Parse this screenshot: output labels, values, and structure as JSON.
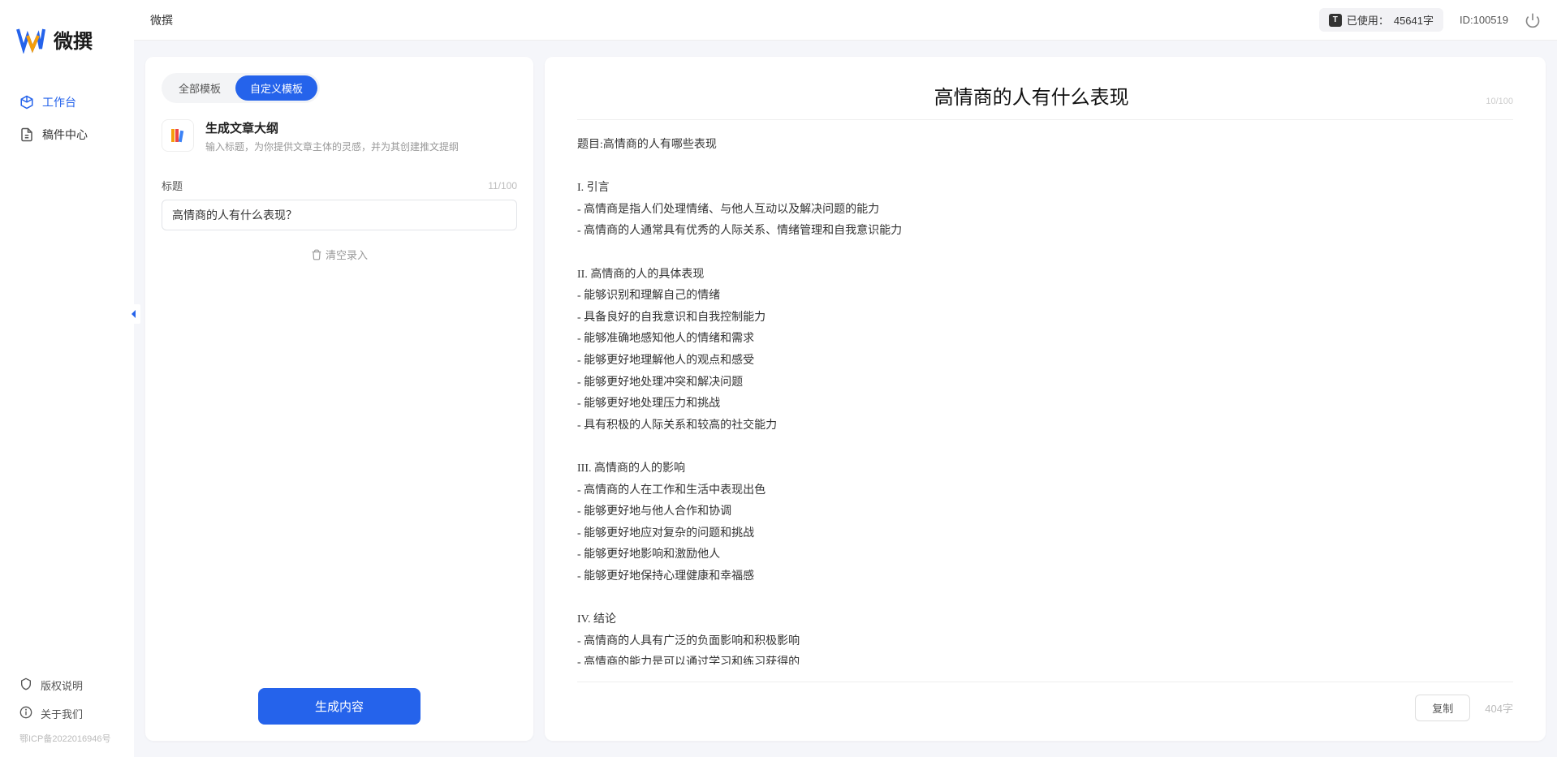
{
  "app": {
    "logo_text": "微撰"
  },
  "sidebar": {
    "nav_items": [
      {
        "label": "工作台",
        "active": true
      },
      {
        "label": "稿件中心",
        "active": false
      }
    ],
    "footer_items": [
      {
        "label": "版权说明"
      },
      {
        "label": "关于我们"
      }
    ],
    "icp": "鄂ICP备2022016946号"
  },
  "topbar": {
    "breadcrumb": "微撰",
    "usage_label": "已使用：",
    "usage_value": "45641字",
    "user_id_label": "ID:100519"
  },
  "form": {
    "tabs": [
      {
        "label": "全部模板",
        "active": false
      },
      {
        "label": "自定义模板",
        "active": true
      }
    ],
    "template_title": "生成文章大纲",
    "template_desc": "输入标题，为你提供文章主体的灵感，并为其创建推文提纲",
    "field_label": "标题",
    "field_count": "11/100",
    "input_value": "高情商的人有什么表现？",
    "clear_label": "清空录入",
    "generate_label": "生成内容"
  },
  "result": {
    "title": "高情商的人有什么表现",
    "title_count": "10/100",
    "body": "题目:高情商的人有哪些表现\n\nI. 引言\n- 高情商是指人们处理情绪、与他人互动以及解决问题的能力\n- 高情商的人通常具有优秀的人际关系、情绪管理和自我意识能力\n\nII. 高情商的人的具体表现\n- 能够识别和理解自己的情绪\n- 具备良好的自我意识和自我控制能力\n- 能够准确地感知他人的情绪和需求\n- 能够更好地理解他人的观点和感受\n- 能够更好地处理冲突和解决问题\n- 能够更好地处理压力和挑战\n- 具有积极的人际关系和较高的社交能力\n\nIII. 高情商的人的影响\n- 高情商的人在工作和生活中表现出色\n- 能够更好地与他人合作和协调\n- 能够更好地应对复杂的问题和挑战\n- 能够更好地影响和激励他人\n- 能够更好地保持心理健康和幸福感\n\nIV. 结论\n- 高情商的人具有广泛的负面影响和积极影响\n- 高情商的能力是可以通过学习和练习获得的\n- 培养和提高高情商的能力对于个人的职业发展和生活质量至关重要。",
    "copy_label": "复制",
    "word_count": "404字"
  }
}
